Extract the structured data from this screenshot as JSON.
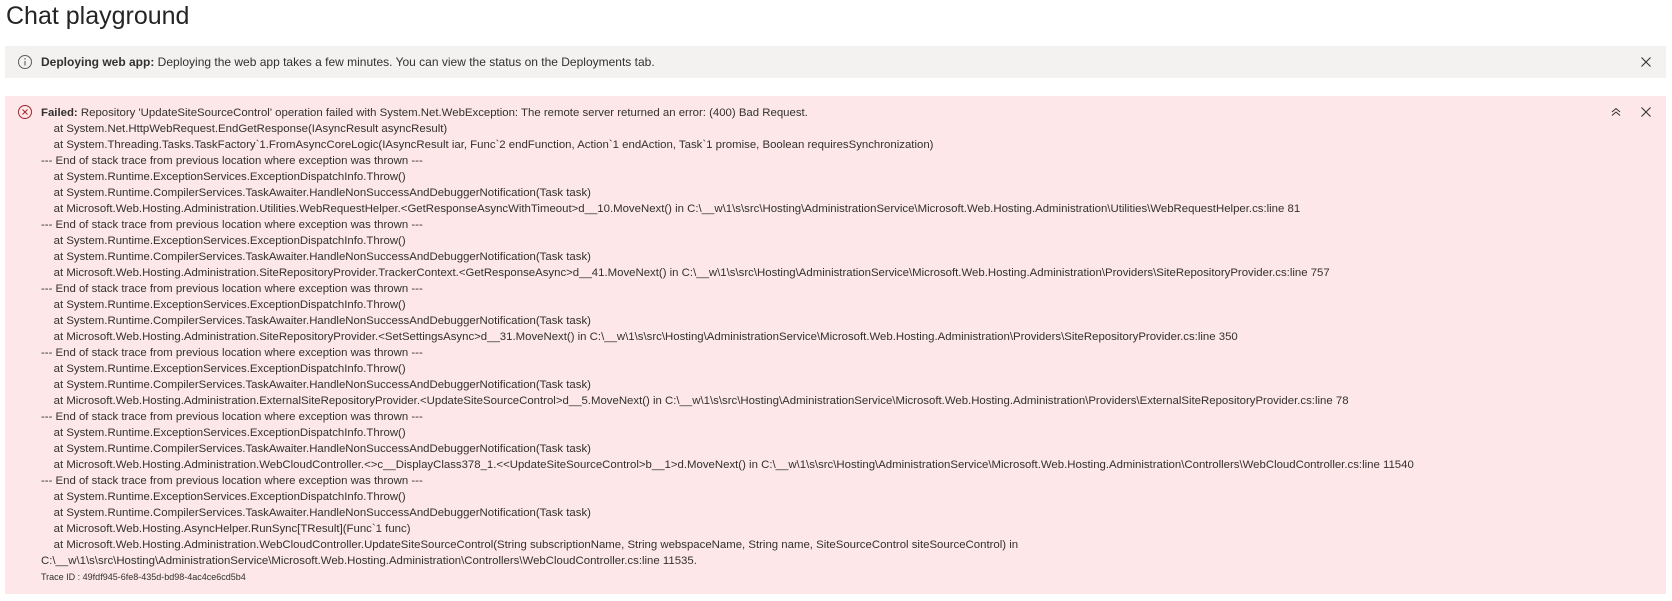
{
  "page": {
    "title": "Chat playground"
  },
  "info_bar": {
    "icon": "info-icon",
    "lead": "Deploying web app:",
    "text": " Deploying the web app takes a few minutes. You can view the status on the Deployments tab."
  },
  "error_bar": {
    "icon": "error-circle-icon",
    "lead": "Failed:",
    "text": " Repository 'UpdateSiteSourceControl' operation failed with System.Net.WebException: The remote server returned an error: (400) Bad Request.",
    "trace": [
      "    at System.Net.HttpWebRequest.EndGetResponse(IAsyncResult asyncResult)",
      "    at System.Threading.Tasks.TaskFactory`1.FromAsyncCoreLogic(IAsyncResult iar, Func`2 endFunction, Action`1 endAction, Task`1 promise, Boolean requiresSynchronization)",
      "--- End of stack trace from previous location where exception was thrown ---",
      "    at System.Runtime.ExceptionServices.ExceptionDispatchInfo.Throw()",
      "    at System.Runtime.CompilerServices.TaskAwaiter.HandleNonSuccessAndDebuggerNotification(Task task)",
      "    at Microsoft.Web.Hosting.Administration.Utilities.WebRequestHelper.<GetResponseAsyncWithTimeout>d__10.MoveNext() in C:\\__w\\1\\s\\src\\Hosting\\AdministrationService\\Microsoft.Web.Hosting.Administration\\Utilities\\WebRequestHelper.cs:line 81",
      "--- End of stack trace from previous location where exception was thrown ---",
      "    at System.Runtime.ExceptionServices.ExceptionDispatchInfo.Throw()",
      "    at System.Runtime.CompilerServices.TaskAwaiter.HandleNonSuccessAndDebuggerNotification(Task task)",
      "    at Microsoft.Web.Hosting.Administration.SiteRepositoryProvider.TrackerContext.<GetResponseAsync>d__41.MoveNext() in C:\\__w\\1\\s\\src\\Hosting\\AdministrationService\\Microsoft.Web.Hosting.Administration\\Providers\\SiteRepositoryProvider.cs:line 757",
      "--- End of stack trace from previous location where exception was thrown ---",
      "    at System.Runtime.ExceptionServices.ExceptionDispatchInfo.Throw()",
      "    at System.Runtime.CompilerServices.TaskAwaiter.HandleNonSuccessAndDebuggerNotification(Task task)",
      "    at Microsoft.Web.Hosting.Administration.SiteRepositoryProvider.<SetSettingsAsync>d__31.MoveNext() in C:\\__w\\1\\s\\src\\Hosting\\AdministrationService\\Microsoft.Web.Hosting.Administration\\Providers\\SiteRepositoryProvider.cs:line 350",
      "--- End of stack trace from previous location where exception was thrown ---",
      "    at System.Runtime.ExceptionServices.ExceptionDispatchInfo.Throw()",
      "    at System.Runtime.CompilerServices.TaskAwaiter.HandleNonSuccessAndDebuggerNotification(Task task)",
      "    at Microsoft.Web.Hosting.Administration.ExternalSiteRepositoryProvider.<UpdateSiteSourceControl>d__5.MoveNext() in C:\\__w\\1\\s\\src\\Hosting\\AdministrationService\\Microsoft.Web.Hosting.Administration\\Providers\\ExternalSiteRepositoryProvider.cs:line 78",
      "--- End of stack trace from previous location where exception was thrown ---",
      "    at System.Runtime.ExceptionServices.ExceptionDispatchInfo.Throw()",
      "    at System.Runtime.CompilerServices.TaskAwaiter.HandleNonSuccessAndDebuggerNotification(Task task)",
      "    at Microsoft.Web.Hosting.Administration.WebCloudController.<>c__DisplayClass378_1.<<UpdateSiteSourceControl>b__1>d.MoveNext() in C:\\__w\\1\\s\\src\\Hosting\\AdministrationService\\Microsoft.Web.Hosting.Administration\\Controllers\\WebCloudController.cs:line 11540",
      "--- End of stack trace from previous location where exception was thrown ---",
      "    at System.Runtime.ExceptionServices.ExceptionDispatchInfo.Throw()",
      "    at System.Runtime.CompilerServices.TaskAwaiter.HandleNonSuccessAndDebuggerNotification(Task task)",
      "    at Microsoft.Web.Hosting.AsyncHelper.RunSync[TResult](Func`1 func)",
      "    at Microsoft.Web.Hosting.Administration.WebCloudController.UpdateSiteSourceControl(String subscriptionName, String webspaceName, String name, SiteSourceControl siteSourceControl) in",
      "C:\\__w\\1\\s\\src\\Hosting\\AdministrationService\\Microsoft.Web.Hosting.Administration\\Controllers\\WebCloudController.cs:line 11535."
    ],
    "trace_id": "Trace ID : 49fdf945-6fe8-435d-bd98-4ac4ce6cd5b4"
  },
  "colors": {
    "info_background": "#f3f2f1",
    "error_background": "#fde7e9",
    "error_icon": "#a4262c"
  }
}
